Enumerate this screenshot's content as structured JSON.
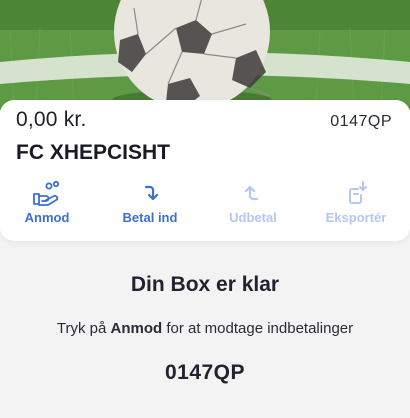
{
  "account": {
    "balance": "0,00 kr.",
    "code": "0147QP",
    "name": "FC XHEPCISHT"
  },
  "actions": [
    {
      "label": "Anmod",
      "icon": "hand-coins-icon",
      "enabled": true
    },
    {
      "label": "Betal ind",
      "icon": "arrow-down-right-icon",
      "enabled": true
    },
    {
      "label": "Udbetal",
      "icon": "arrow-up-left-icon",
      "enabled": false
    },
    {
      "label": "Eksportér",
      "icon": "export-document-icon",
      "enabled": false
    }
  ],
  "box": {
    "title": "Din Box er klar",
    "instruction_prefix": "Tryk på",
    "instruction_emphasis": "Anmod",
    "instruction_suffix": "for at modtage indbetalinger",
    "code": "0147QP"
  },
  "colors": {
    "accent": "#3b6ed6",
    "accent_disabled": "#b4c7ee",
    "background": "#f3f3f4"
  }
}
